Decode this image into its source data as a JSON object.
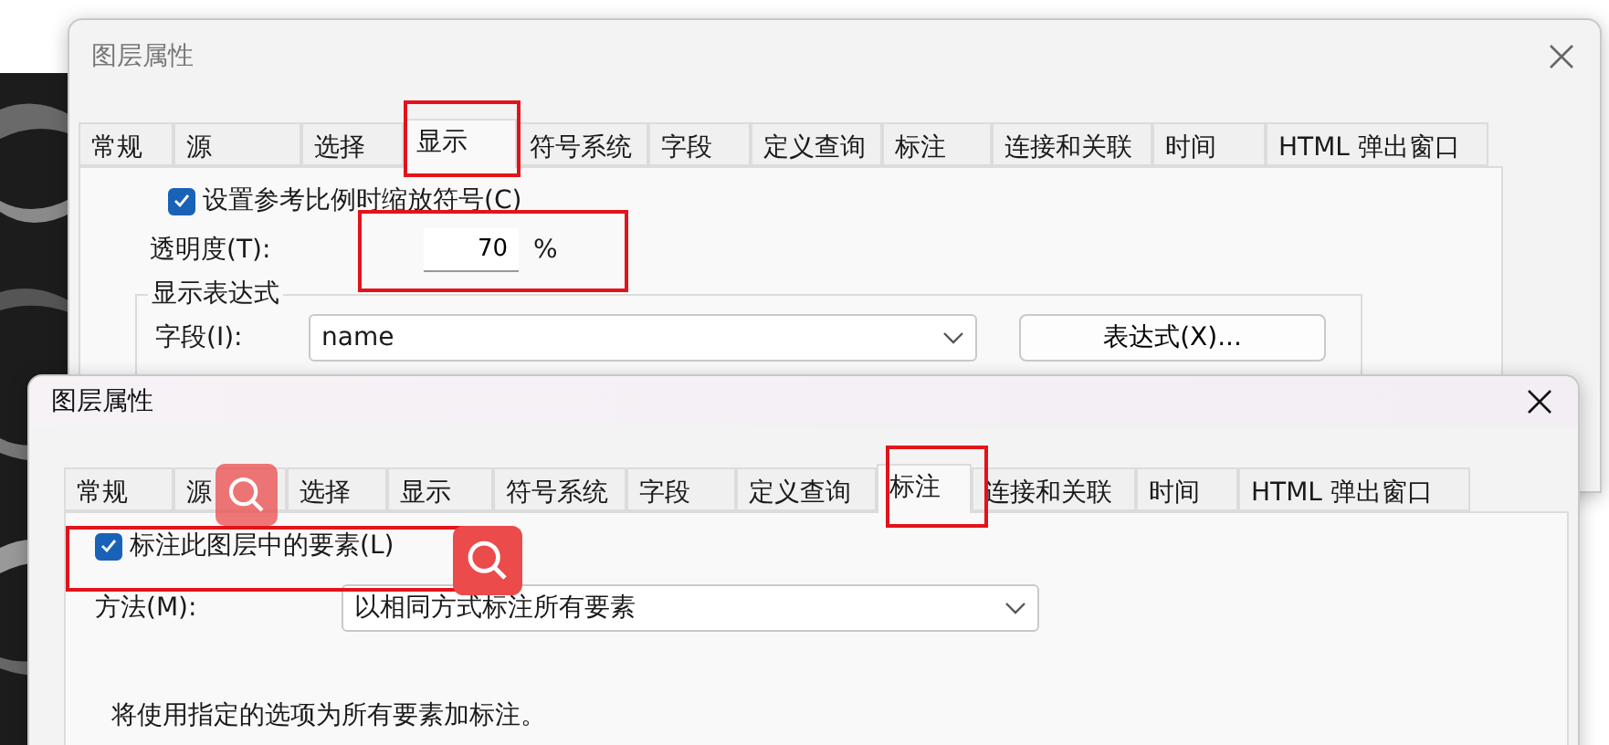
{
  "dialogs": [
    {
      "title": "图层属性",
      "active": false,
      "tabs": [
        {
          "label": "常规",
          "selected": false
        },
        {
          "label": "源",
          "selected": false
        },
        {
          "label": "选择",
          "selected": false
        },
        {
          "label": "显示",
          "selected": true
        },
        {
          "label": "符号系统",
          "selected": false
        },
        {
          "label": "字段",
          "selected": false
        },
        {
          "label": "定义查询",
          "selected": false
        },
        {
          "label": "标注",
          "selected": false
        },
        {
          "label": "连接和关联",
          "selected": false
        },
        {
          "label": "时间",
          "selected": false
        },
        {
          "label": "HTML 弹出窗口",
          "selected": false
        }
      ],
      "content": [
        {
          "kind": "checkbox",
          "label": "设置参考比例时缩放符号(C)",
          "checked": true
        },
        {
          "kind": "number",
          "label": "透明度(T):",
          "value": "70",
          "unit": "%"
        },
        {
          "kind": "group",
          "title": "显示表达式",
          "children": [
            {
              "kind": "select",
              "label": "字段(I):",
              "value": "name",
              "button": "表达式(X)..."
            }
          ]
        }
      ]
    },
    {
      "title": "图层属性",
      "active": true,
      "tabs": [
        {
          "label": "常规",
          "selected": false
        },
        {
          "label": "源",
          "selected": false
        },
        {
          "label": "选择",
          "selected": false
        },
        {
          "label": "显示",
          "selected": false
        },
        {
          "label": "符号系统",
          "selected": false
        },
        {
          "label": "字段",
          "selected": false
        },
        {
          "label": "定义查询",
          "selected": false
        },
        {
          "label": "标注",
          "selected": true
        },
        {
          "label": "连接和关联",
          "selected": false
        },
        {
          "label": "时间",
          "selected": false
        },
        {
          "label": "HTML 弹出窗口",
          "selected": false
        }
      ],
      "content": [
        {
          "kind": "checkbox",
          "label": "标注此图层中的要素(L)",
          "checked": true
        },
        {
          "kind": "select",
          "label": "方法(M):",
          "value": "以相同方式标注所有要素"
        },
        {
          "kind": "note",
          "text": "将使用指定的选项为所有要素加标注。"
        }
      ]
    }
  ]
}
